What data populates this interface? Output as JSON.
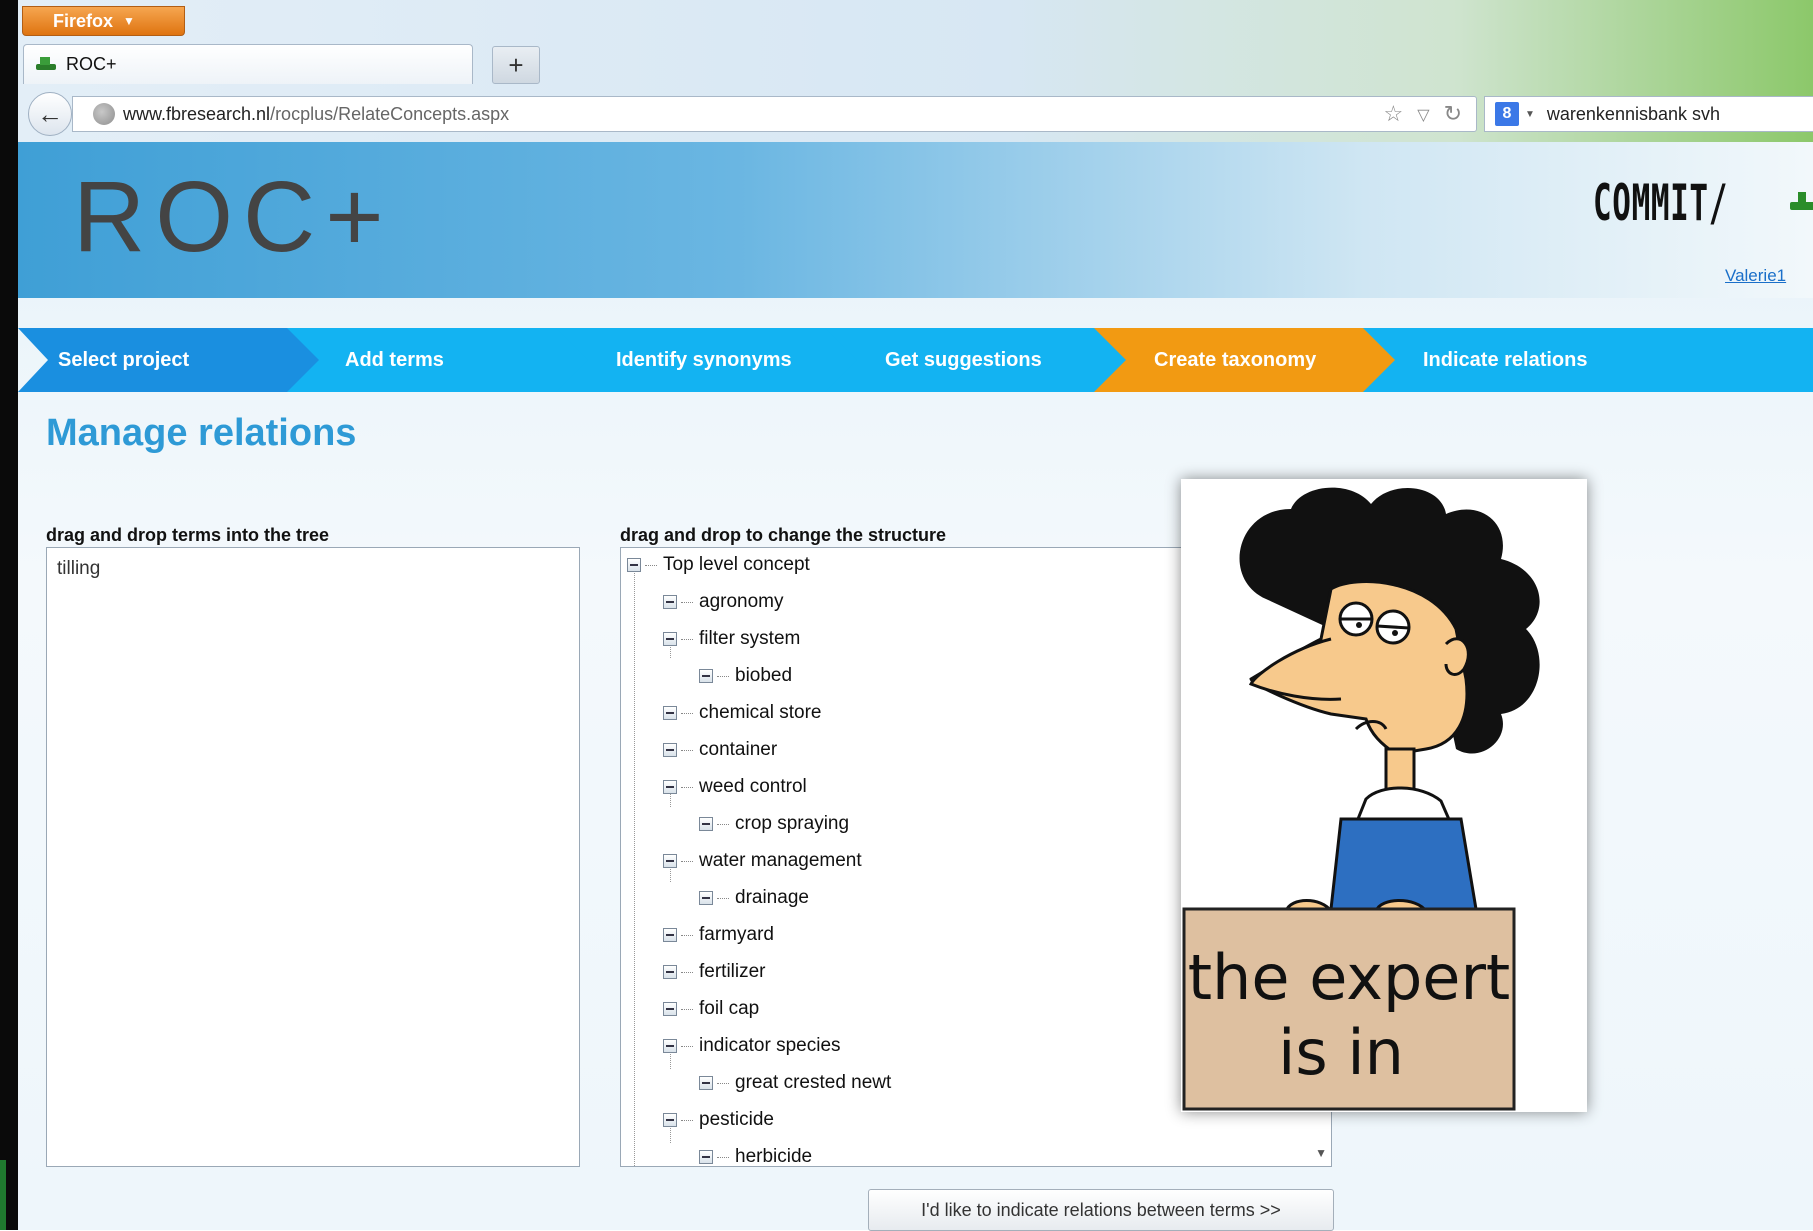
{
  "browser": {
    "menu_button": "Firefox",
    "tab_title": "ROC+",
    "new_tab_symbol": "+",
    "url_domain": "www.fbresearch.nl",
    "url_path": "/rocplus/RelateConcepts.aspx",
    "search_engine_letter": "8",
    "search_query": "warenkennisbank svh"
  },
  "header": {
    "logo": "ROC+",
    "partner_logo": "COMMIT/",
    "user_link": "Valerie1"
  },
  "steps": [
    {
      "label": "Select project",
      "color": "#1a8fe0"
    },
    {
      "label": "Add terms",
      "color": "#13b3f2"
    },
    {
      "label": "Identify synonyms",
      "color": "#13b3f2"
    },
    {
      "label": "Get suggestions",
      "color": "#13b3f2"
    },
    {
      "label": "Create taxonomy",
      "color": "#f29a12"
    },
    {
      "label": "Indicate relations",
      "color": "#13b3f2"
    }
  ],
  "main": {
    "title": "Manage relations",
    "terms_label": "drag and drop terms into the tree",
    "tree_label": "drag and drop to change the structure",
    "terms": [
      "tilling"
    ],
    "tree": [
      {
        "label": "Top level concept",
        "level": 0
      },
      {
        "label": "agronomy",
        "level": 1
      },
      {
        "label": "filter system",
        "level": 1
      },
      {
        "label": "biobed",
        "level": 2
      },
      {
        "label": "chemical store",
        "level": 1
      },
      {
        "label": "container",
        "level": 1
      },
      {
        "label": "weed control",
        "level": 1
      },
      {
        "label": "crop spraying",
        "level": 2
      },
      {
        "label": "water management",
        "level": 1
      },
      {
        "label": "drainage",
        "level": 2
      },
      {
        "label": "farmyard",
        "level": 1
      },
      {
        "label": "fertilizer",
        "level": 1
      },
      {
        "label": "foil cap",
        "level": 1
      },
      {
        "label": "indicator species",
        "level": 1
      },
      {
        "label": "great crested newt",
        "level": 2
      },
      {
        "label": "pesticide",
        "level": 1
      },
      {
        "label": "herbicide",
        "level": 2
      }
    ],
    "next_button": "I'd like to indicate relations between terms >>"
  },
  "cartoon": {
    "sign_line1": "the expert",
    "sign_line2": "is in"
  }
}
